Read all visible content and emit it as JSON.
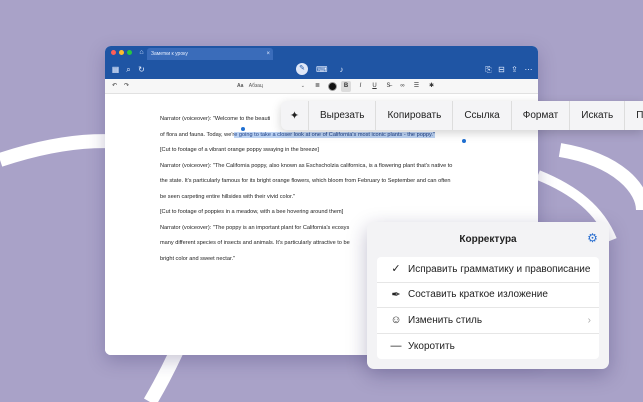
{
  "window": {
    "doc_tab": "Заметки к уроку",
    "style_select": "Абзац"
  },
  "toolbar_icons": [
    "grid-icon",
    "search-icon",
    "refresh-icon",
    "pen-icon",
    "keyboard-icon",
    "microphone-icon",
    "export-icon",
    "bookmark-icon",
    "share-icon",
    "more-icon"
  ],
  "format_icons": [
    "undo-icon",
    "redo-icon",
    "list-icon",
    "color-icon",
    "bold-icon",
    "italic-icon",
    "underline-icon",
    "strikethrough-icon",
    "link-icon",
    "bullets-icon",
    "magic-icon"
  ],
  "document": {
    "lines": [
      {
        "before": "Narrator (voiceover): \"Welcome to the beauti",
        "hl": "",
        "after": ""
      },
      {
        "before": "of flora and fauna. Today, we'r",
        "hl": "e going to take a closer look at one of California's most iconic plants - the poppy.\"",
        "after": ""
      },
      {
        "before": "[Cut to footage of a vibrant orange poppy swaying in the breeze]",
        "hl": "",
        "after": ""
      },
      {
        "before": "Narrator (voiceover): \"The California poppy, also known as Eschscholzia californica, is a flowering plant that's native to",
        "hl": "",
        "after": ""
      },
      {
        "before": "the state. It's particularly famous for its bright orange flowers, which bloom from February to September and can often",
        "hl": "",
        "after": ""
      },
      {
        "before": "be seen carpeting entire hillsides with their vivid color.\"",
        "hl": "",
        "after": ""
      },
      {
        "before": "[Cut to footage of poppies in a meadow, with a bee hovering around them]",
        "hl": "",
        "after": ""
      },
      {
        "before": "Narrator (voiceover): \"The poppy is an important plant for California's ecosys",
        "hl": "",
        "after": ""
      },
      {
        "before": "many different species of insects and animals. It's particularly attractive to be",
        "hl": "",
        "after": ""
      },
      {
        "before": "bright color and sweet nectar.\"",
        "hl": "",
        "after": ""
      }
    ]
  },
  "context_menu": {
    "ai_icon": "sparkle-icon",
    "items": [
      "Вырезать",
      "Копировать",
      "Ссылка",
      "Формат",
      "Искать",
      "Переве"
    ]
  },
  "panel": {
    "title": "Корректура",
    "gear_icon": "gear-icon",
    "items": [
      {
        "icon": "check-circle-icon",
        "label": "Исправить грамматику и правописание",
        "chevron": false
      },
      {
        "icon": "feather-icon",
        "label": "Составить краткое изложение",
        "chevron": false
      },
      {
        "icon": "smile-icon",
        "label": "Изменить стиль",
        "chevron": true
      },
      {
        "icon": "dash-icon",
        "label": "Укоротить",
        "chevron": false
      }
    ]
  },
  "colors": {
    "background": "#a9a2c8",
    "titlebar": "#1f55a4",
    "selection": "#bcd3f3",
    "accent": "#2a6fd0"
  }
}
